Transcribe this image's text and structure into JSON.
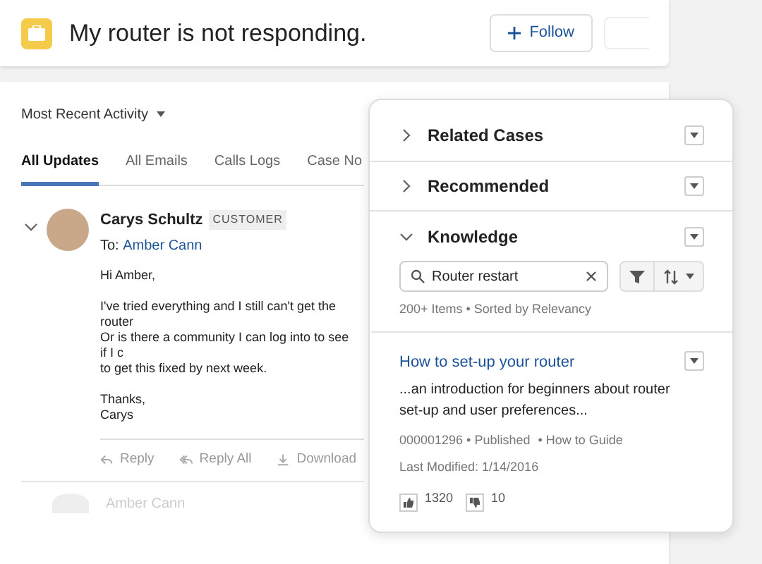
{
  "header": {
    "title": "My router is not responding.",
    "follow_button": "Follow"
  },
  "feed": {
    "filter": "Most Recent Activity",
    "tabs": [
      {
        "label": "All Updates",
        "selected": true
      },
      {
        "label": "All Emails",
        "selected": false
      },
      {
        "label": "Calls Logs",
        "selected": false
      },
      {
        "label": "Case No",
        "selected": false
      }
    ],
    "email": {
      "expanded": true,
      "sender": "Carys Schultz",
      "badge": "CUSTOMER",
      "to_label": "To:",
      "recipient": "Amber Cann",
      "paragraphs": [
        {
          "lines": [
            "Hi Amber,"
          ]
        },
        {
          "lines": [
            "I've tried everything and I still can't get the router",
            "Or is there a community I can log into to see if I c",
            "to get this fixed by next week."
          ]
        },
        {
          "lines": [
            "Thanks,",
            "Carys"
          ]
        }
      ],
      "actions": [
        {
          "kind": "reply",
          "label": "Reply"
        },
        {
          "kind": "reply-all",
          "label": "Reply All"
        },
        {
          "kind": "download",
          "label": "Download"
        }
      ]
    },
    "next_sender": "Amber Cann"
  },
  "panel": {
    "sections": [
      {
        "title": "Related Cases",
        "expanded": false
      },
      {
        "title": "Recommended",
        "expanded": false
      },
      {
        "title": "Knowledge",
        "expanded": true
      }
    ],
    "search": {
      "value": "Router restart"
    },
    "summary": "200+ Items • Sorted by Relevancy",
    "article": {
      "title": "How to set-up your router",
      "snippet": "...an introduction for beginners about router set-up and user preferences...",
      "number_status": "000001296 • Published",
      "type": "• How to Guide",
      "modified": "Last Modified: 1/14/2016",
      "likes": "1320",
      "dislikes": "10"
    }
  }
}
